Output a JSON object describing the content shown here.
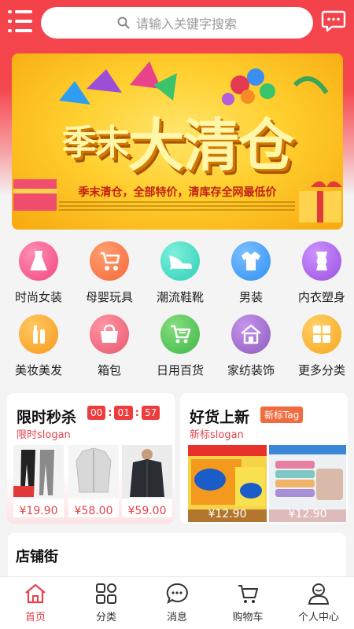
{
  "header": {
    "search_placeholder": "请输入关键字搜索",
    "menu_icon": "menu-icon",
    "message_icon": "message-icon"
  },
  "banner": {
    "title_small": "季末",
    "title_big": "大清仓",
    "subtitle": "季末清仓，全部特价，清库存全网最低价"
  },
  "categories": [
    {
      "label": "时尚女装",
      "icon": "dress-icon",
      "color": "#f2457e"
    },
    {
      "label": "母婴玩具",
      "icon": "stroller-icon",
      "color": "#f8663a"
    },
    {
      "label": "潮流鞋靴",
      "icon": "heel-icon",
      "color": "#2fcfb7"
    },
    {
      "label": "男装",
      "icon": "shirt-icon",
      "color": "#2f8ff3"
    },
    {
      "label": "内衣塑身",
      "icon": "bodysuit-icon",
      "color": "#9a4fe0"
    },
    {
      "label": "美妆美发",
      "icon": "cosmetics-icon",
      "color": "#f89a1c"
    },
    {
      "label": "箱包",
      "icon": "handbag-icon",
      "color": "#e8586d"
    },
    {
      "label": "日用百货",
      "icon": "cart-icon",
      "color": "#3fb748"
    },
    {
      "label": "家纺装饰",
      "icon": "home-icon",
      "color": "#8e5bbd"
    },
    {
      "label": "更多分类",
      "icon": "grid-icon",
      "color": "#f7a51c"
    }
  ],
  "flash_sale": {
    "title": "限时秒杀",
    "timer": [
      "00",
      "01",
      "57"
    ],
    "slogan": "限时slogan",
    "products": [
      {
        "price": "¥19.90"
      },
      {
        "price": "¥58.00"
      },
      {
        "price": "¥59.00"
      }
    ]
  },
  "new_arrivals": {
    "title": "好货上新",
    "tag": "新标Tag",
    "slogan": "新标slogan",
    "products": [
      {
        "price": "¥12.90"
      },
      {
        "price": "¥12.90"
      }
    ]
  },
  "shop_street": {
    "title": "店铺街"
  },
  "tabbar": [
    {
      "label": "首页",
      "icon": "home-tab-icon",
      "active": true
    },
    {
      "label": "分类",
      "icon": "category-tab-icon",
      "active": false
    },
    {
      "label": "消息",
      "icon": "message-tab-icon",
      "active": false
    },
    {
      "label": "购物车",
      "icon": "cart-tab-icon",
      "active": false
    },
    {
      "label": "个人中心",
      "icon": "user-tab-icon",
      "active": false
    }
  ],
  "colors": {
    "brand_red": "#f4424a",
    "price_red": "#e6434b"
  }
}
